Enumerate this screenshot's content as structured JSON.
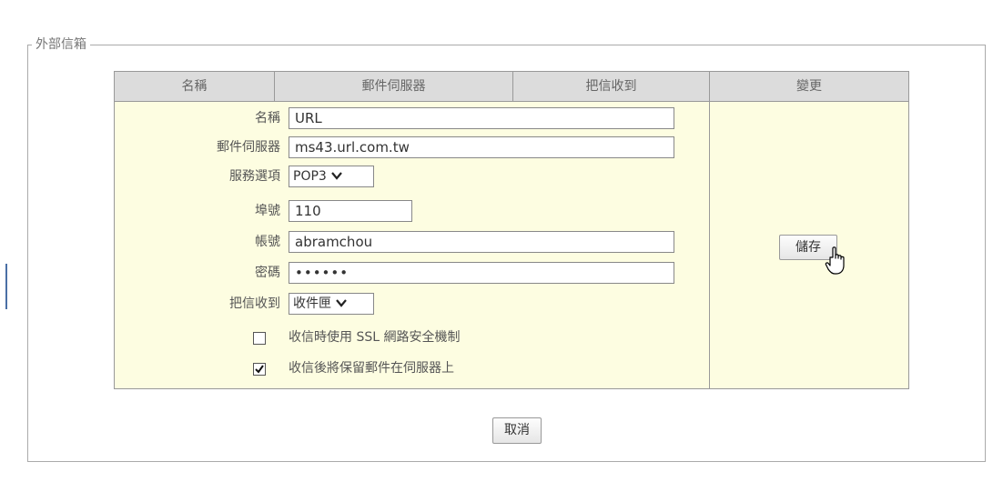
{
  "section": {
    "legend": "外部信箱"
  },
  "table": {
    "headers": [
      "名稱",
      "郵件伺服器",
      "把信收到",
      "變更"
    ]
  },
  "form": {
    "name_label": "名稱",
    "name_value": "URL",
    "server_label": "郵件伺服器",
    "server_value": "ms43.url.com.tw",
    "service_label": "服務選項",
    "service_value": "POP3",
    "port_label": "埠號",
    "port_value": "110",
    "account_label": "帳號",
    "account_value": "abramchou",
    "password_label": "密碼",
    "password_value": "••••••",
    "deliver_label": "把信收到",
    "deliver_value": "收件匣",
    "ssl_label": "收信時使用 SSL 網路安全機制",
    "ssl_checked": false,
    "keep_label": "收信後將保留郵件在伺服器上",
    "keep_checked": true
  },
  "actions": {
    "save_label": "儲存",
    "cancel_label": "取消"
  },
  "icons": {
    "dropdown": "chevron-down-icon",
    "cursor": "hand-pointer-icon",
    "check": "checkmark-icon"
  }
}
